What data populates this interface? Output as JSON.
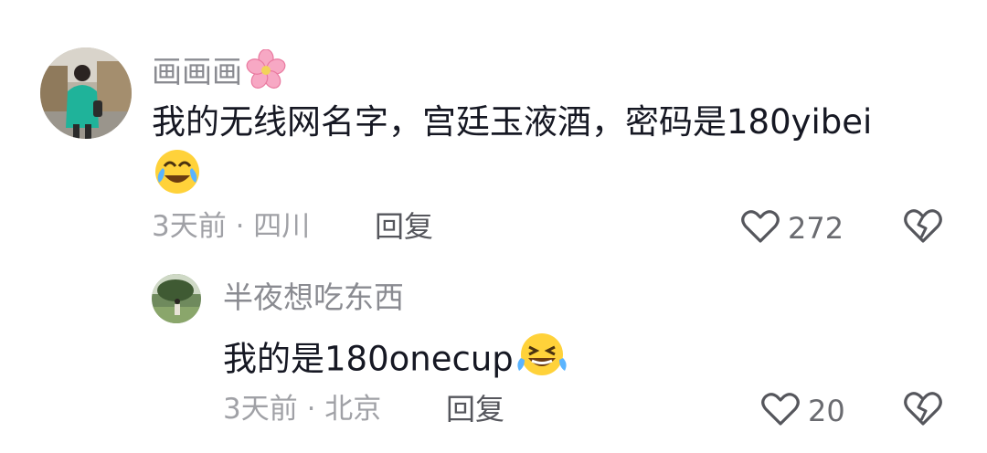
{
  "comments": [
    {
      "username": "画画画",
      "username_emoji": "cherry-blossom-icon",
      "text": "我的无线网名字，宫廷玉液酒，密码是180yibei",
      "trailing_emoji": "tears-of-joy-emoji",
      "meta": "3天前 · 四川",
      "reply_label": "回复",
      "like_count": "272"
    },
    {
      "username": "半夜想吃东西",
      "text": "我的是180onecup",
      "trailing_emoji": "laughing-crying-emoji",
      "meta": "3天前 · 北京",
      "reply_label": "回复",
      "like_count": "20"
    }
  ],
  "colors": {
    "text": "#161823",
    "username": "#8a8b91",
    "meta": "#a0a1a6",
    "icon": "#55565c"
  }
}
